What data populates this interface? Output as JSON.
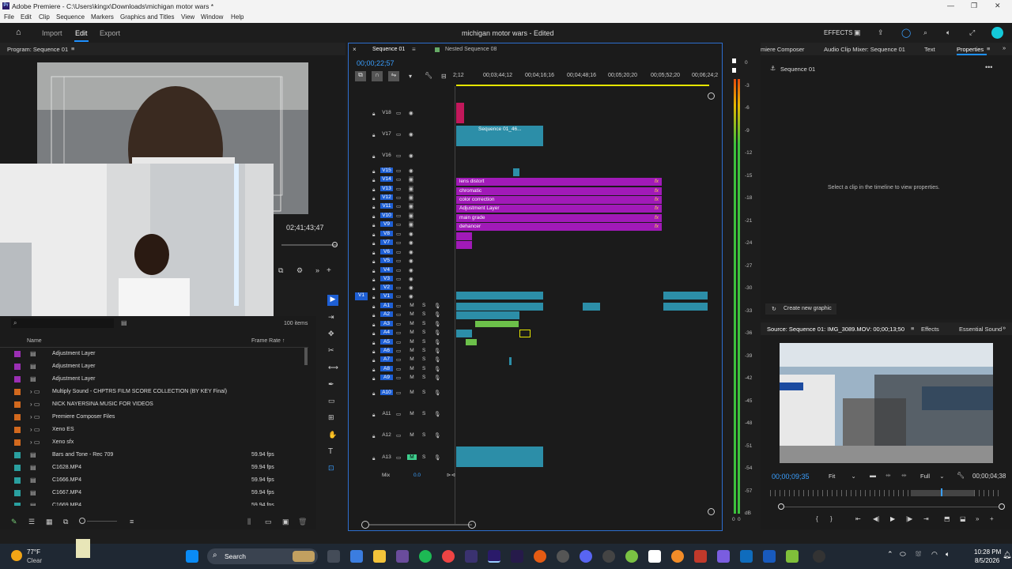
{
  "window": {
    "title": "Adobe Premiere - C:\\Users\\kingx\\Downloads\\michigan motor wars *",
    "logo": "Pr"
  },
  "menu": [
    "File",
    "Edit",
    "Clip",
    "Sequence",
    "Markers",
    "Graphics and Titles",
    "View",
    "Window",
    "Help"
  ],
  "header": {
    "tabs": [
      "Import",
      "Edit",
      "Export"
    ],
    "active_tab": "Edit",
    "project_title": "michigan motor wars",
    "edited": "- Edited",
    "effects_label": "EFFECTS"
  },
  "program": {
    "title": "Program: Sequence 01",
    "timecode": "02;41;43;47"
  },
  "project": {
    "items_count": "100 items",
    "col_name": "Name",
    "col_frame": "Frame Rate",
    "rows": [
      {
        "name": "Adjustment Layer",
        "fps": "",
        "color": "#9b2fb4"
      },
      {
        "name": "Adjustment Layer",
        "fps": "",
        "color": "#9b2fb4"
      },
      {
        "name": "Adjustment Layer",
        "fps": "",
        "color": "#9b2fb4"
      },
      {
        "name": "Multiply Sound - CHPTRS FILM SCORE COLLECTION (BY KEY Final)",
        "fps": "",
        "color": "#d2691e"
      },
      {
        "name": "NICK NAYERSINA MUSIC FOR VIDEOS",
        "fps": "",
        "color": "#d2691e"
      },
      {
        "name": "Premiere Composer Files",
        "fps": "",
        "color": "#d2691e"
      },
      {
        "name": "Xeno ES",
        "fps": "",
        "color": "#d2691e"
      },
      {
        "name": "Xeno sfx",
        "fps": "",
        "color": "#d2691e"
      },
      {
        "name": "Bars and Tone - Rec 709",
        "fps": "59.94 fps",
        "color": "#2aa0a0"
      },
      {
        "name": "C1628.MP4",
        "fps": "59.94 fps",
        "color": "#2aa0a0"
      },
      {
        "name": "C1666.MP4",
        "fps": "59.94 fps",
        "color": "#2aa0a0"
      },
      {
        "name": "C1667.MP4",
        "fps": "59.94 fps",
        "color": "#2aa0a0"
      },
      {
        "name": "C1669.MP4",
        "fps": "59.94 fps",
        "color": "#2aa0a0"
      }
    ]
  },
  "timeline": {
    "tab_active": "Sequence 01",
    "tab_other": "Nested Sequence 08",
    "timecode": "00;00;22;57",
    "ruler": [
      "2;12",
      "00;03;44;12",
      "00;04;16;16",
      "00;04;48;16",
      "00;05;20;20",
      "00;05;52;20",
      "00;06;24;2"
    ],
    "video_tracks": [
      "V18",
      "V17",
      "V16",
      "V15",
      "V14",
      "V13",
      "V12",
      "V11",
      "V10",
      "V9",
      "V8",
      "V7",
      "V6",
      "V5",
      "V4",
      "V3",
      "V2",
      "V1"
    ],
    "audio_tracks": [
      "A1",
      "A2",
      "A3",
      "A4",
      "A5",
      "A6",
      "A7",
      "A8",
      "A9",
      "A10",
      "A11",
      "A12",
      "A13"
    ],
    "mix_label": "Mix",
    "mix_value": "0.0",
    "nested_clip": "Sequence 01_46...",
    "adjust_clips": [
      "lens distort",
      "chromatic",
      "color correction",
      "Adjustment Layer",
      "main grade",
      "dehancer"
    ],
    "fx": "fx",
    "m": "M",
    "s": "S"
  },
  "meters": {
    "labels": [
      "0",
      "-3",
      "-6",
      "-9",
      "-12",
      "-15",
      "-18",
      "-21",
      "-24",
      "-27",
      "-30",
      "-33",
      "-36",
      "-39",
      "-42",
      "-45",
      "-48",
      "-51",
      "-54",
      "-57",
      "dB"
    ],
    "bottom": [
      "0",
      "0"
    ]
  },
  "properties": {
    "tabs": [
      "miere Composer",
      "Audio Clip Mixer: Sequence 01",
      "Text",
      "Properties"
    ],
    "sequence": "Sequence 01",
    "message": "Select a clip in the timeline to view properties.",
    "new_graphic": "Create new graphic"
  },
  "source": {
    "tabs": [
      "Source: Sequence 01: IMG_3089.MOV: 00;00;13;50",
      "Effects",
      "Essential Sound"
    ],
    "timecode": "00;00;09;35",
    "fit": "Fit",
    "full": "Full",
    "end_tc": "00;00;04;38"
  },
  "taskbar": {
    "weather_temp": "77°F",
    "weather_desc": "Clear",
    "search": "Search",
    "time": "10:28 PM",
    "date": "8/5/2026"
  },
  "colors": {
    "accent": "#1e90ff",
    "purple": "#a11ab8",
    "teal": "#2c8ea8",
    "green_audio": "#6cc04a",
    "ruler_yellow": "#e6e600"
  }
}
